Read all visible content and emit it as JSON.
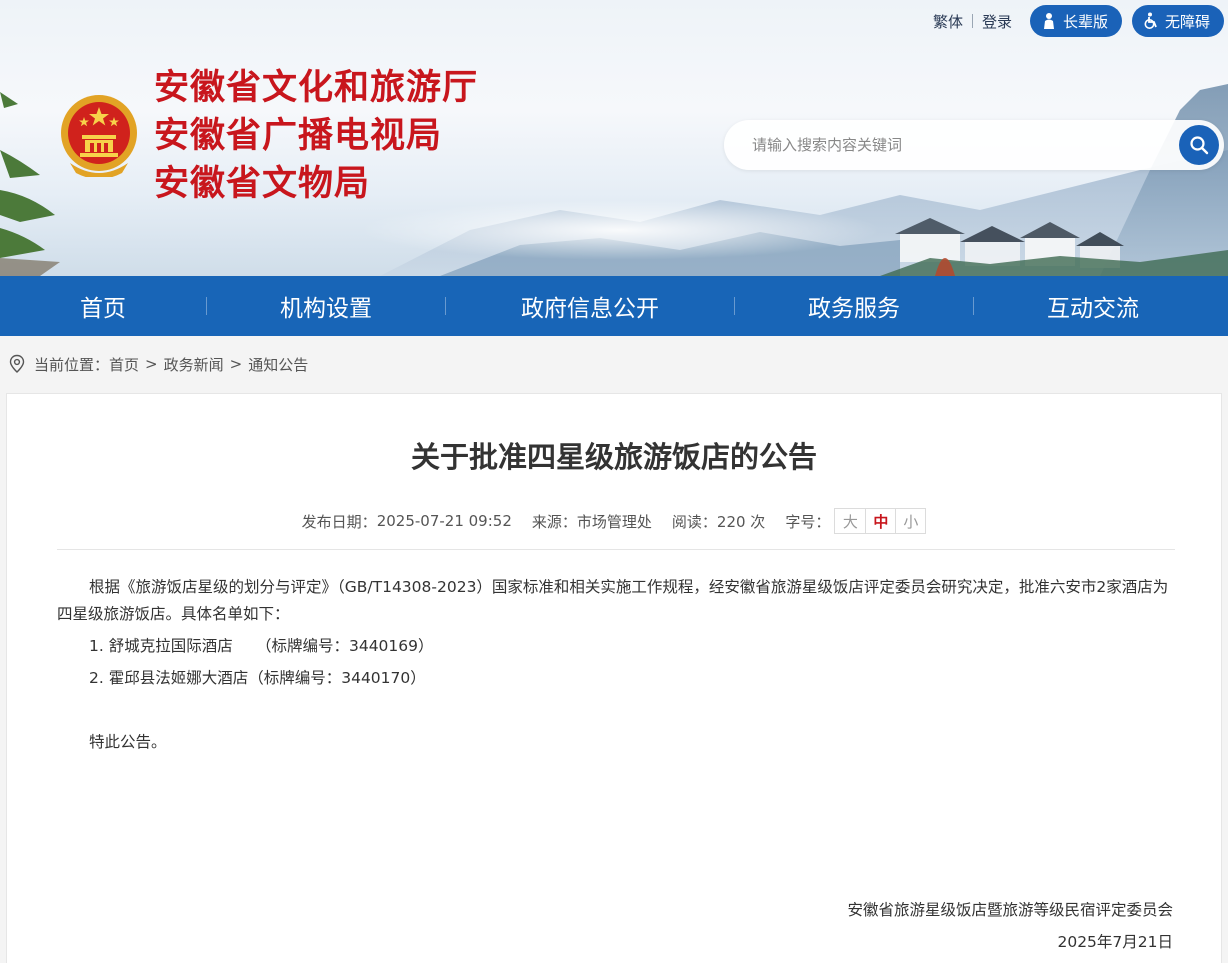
{
  "header": {
    "top_links": {
      "traditional": "繁体",
      "login": "登录"
    },
    "pills": {
      "elder": "长辈版",
      "accessible": "无障碍"
    },
    "site_names": [
      "安徽省文化和旅游厅",
      "安徽省广播电视局",
      "安徽省文物局"
    ],
    "search": {
      "placeholder": "请输入搜索内容关键词"
    }
  },
  "nav": {
    "items": [
      {
        "label": "首页"
      },
      {
        "label": "机构设置"
      },
      {
        "label": "政府信息公开"
      },
      {
        "label": "政务服务"
      },
      {
        "label": "互动交流"
      }
    ]
  },
  "breadcrumb": {
    "prefix": "当前位置：",
    "items": [
      "首页",
      "政务新闻",
      "通知公告"
    ],
    "separator": ">"
  },
  "article": {
    "title": "关于批准四星级旅游饭店的公告",
    "meta": {
      "date_label": "发布日期：",
      "date": "2025-07-21 09:52",
      "source_label": "来源：",
      "source": "市场管理处",
      "views_label": "阅读：",
      "views": "220 次",
      "font_label": "字号：",
      "font_sizes": [
        "大",
        "中",
        "小"
      ],
      "font_selected": "中"
    },
    "paragraph": "根据《旅游饭店星级的划分与评定》（GB/T14308-2023）国家标准和相关实施工作规程，经安徽省旅游星级饭店评定委员会研究决定，批准六安市2家酒店为四星级旅游饭店。具体名单如下：",
    "list": [
      "1. 舒城克拉国际酒店　　（标牌编号：3440169）",
      "2. 霍邱县法姬娜大酒店（标牌编号：3440170）"
    ],
    "closing": "特此公告。",
    "signature": "安徽省旅游星级饭店暨旅游等级民宿评定委员会",
    "sign_date": "2025年7月21日"
  },
  "colors": {
    "brand_blue": "#1865b7",
    "title_red": "#c8161d"
  }
}
